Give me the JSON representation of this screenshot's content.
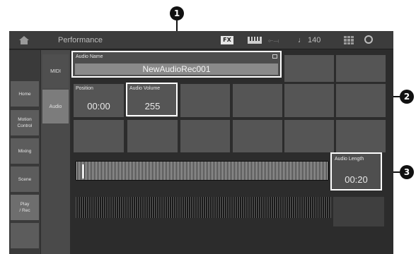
{
  "callouts": [
    "1",
    "2",
    "3"
  ],
  "header": {
    "title": "Performance",
    "fx_badge": "FX",
    "tempo": "♩ 140",
    "icons": [
      "home-icon",
      "keyboard-icon",
      "usb-icon",
      "grid-icon",
      "settings-icon"
    ]
  },
  "nav": {
    "items": [
      "Home",
      "Motion Control",
      "Mixing",
      "Scene",
      "Play / Rec"
    ],
    "active": "Play / Rec"
  },
  "subnav": {
    "items": [
      "MIDI",
      "Audio"
    ],
    "active": "Audio"
  },
  "audio": {
    "name_label": "Audio Name",
    "name_value": "NewAudioRec001",
    "position_label": "Position",
    "position_value": "00:00",
    "volume_label": "Audio Volume",
    "volume_value": "255",
    "length_label": "Audio Length",
    "length_value": "00:20"
  }
}
